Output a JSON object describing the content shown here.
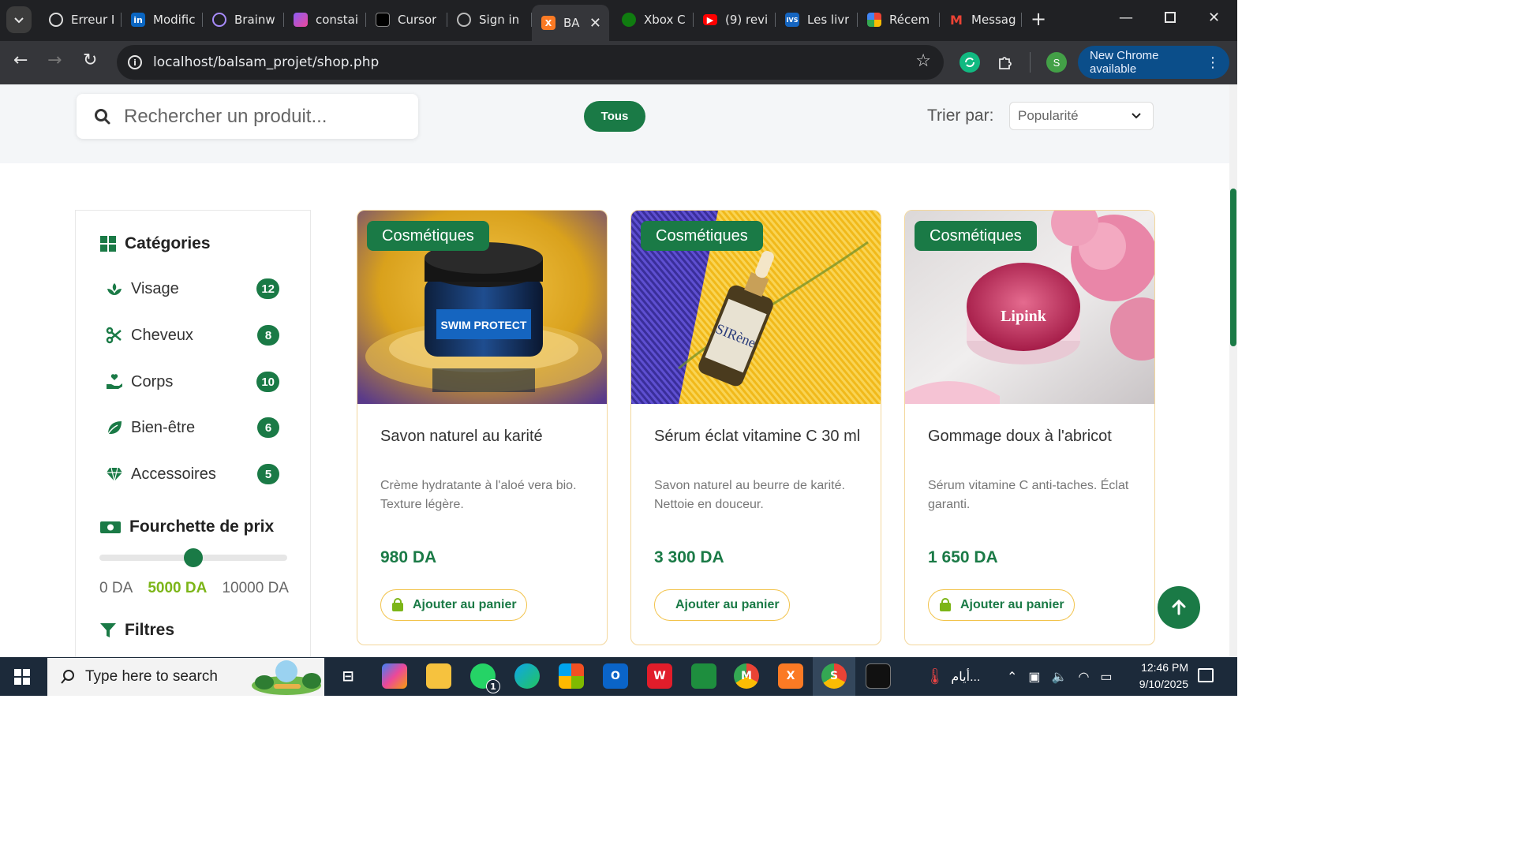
{
  "browser": {
    "tabs": [
      {
        "title": "Erreur I",
        "icon": "openai-icon"
      },
      {
        "title": "Modific",
        "icon": "linkedin-icon"
      },
      {
        "title": "Brainw",
        "icon": "brain-icon"
      },
      {
        "title": "constai",
        "icon": "canva-icon"
      },
      {
        "title": "Cursor",
        "icon": "cursor-icon"
      },
      {
        "title": "Sign in",
        "icon": "globe-icon"
      },
      {
        "title": "BA",
        "icon": "xampp-icon",
        "active": true
      },
      {
        "title": "Xbox C",
        "icon": "xbox-icon"
      },
      {
        "title": "(9) revi",
        "icon": "youtube-icon"
      },
      {
        "title": "Les livr",
        "icon": "books-icon"
      },
      {
        "title": "Récem",
        "icon": "photos-icon"
      },
      {
        "title": "Messag",
        "icon": "gmail-icon"
      }
    ],
    "url": "localhost/balsam_projet/shop.php",
    "update_label": "New Chrome available",
    "profile_initial": "S"
  },
  "filterbar": {
    "search_placeholder": "Rechercher un produit...",
    "all_label": "Tous",
    "sort_label": "Trier par:",
    "sort_value": "Popularité"
  },
  "sidebar": {
    "categories_title": "Catégories",
    "categories": [
      {
        "label": "Visage",
        "count": "12",
        "icon": "spa-icon"
      },
      {
        "label": "Cheveux",
        "count": "8",
        "icon": "scissors-icon"
      },
      {
        "label": "Corps",
        "count": "10",
        "icon": "hand-heart-icon"
      },
      {
        "label": "Bien-être",
        "count": "6",
        "icon": "leaf-icon"
      },
      {
        "label": "Accessoires",
        "count": "5",
        "icon": "gem-icon"
      }
    ],
    "price_title": "Fourchette de prix",
    "price_min": "0 DA",
    "price_current": "5000 DA",
    "price_max": "10000 DA",
    "price_fraction": 0.5,
    "filters_title": "Filtres"
  },
  "products": [
    {
      "tag": "Cosmétiques",
      "name": "Savon naturel au karité",
      "desc": "Crème hydratante à l'aloé vera bio. Texture légère.",
      "price": "980 DA",
      "button": "Ajouter au panier",
      "img_text": "SWIM PROTECT"
    },
    {
      "tag": "Cosmétiques",
      "name": "Sérum éclat vitamine C 30 ml",
      "desc": "Savon naturel au beurre de karité. Nettoie en douceur.",
      "price": "3 300 DA",
      "button": "Ajouter au panier",
      "img_text": "SIRène"
    },
    {
      "tag": "Cosmétiques",
      "name": "Gommage doux à l'abricot",
      "desc": "Sérum vitamine C anti-taches. Éclat garanti.",
      "price": "1 650 DA",
      "button": "Ajouter au panier",
      "img_text": "Lipink"
    }
  ],
  "taskbar": {
    "search_placeholder": "Type here to search",
    "weather_text": "أيام...",
    "time": "12:46 PM",
    "date": "9/10/2025",
    "whatsapp_badge": "1"
  },
  "colors": {
    "brand_green": "#1a7a46",
    "accent_yellow": "#f2c34b",
    "lime": "#7cb518"
  }
}
